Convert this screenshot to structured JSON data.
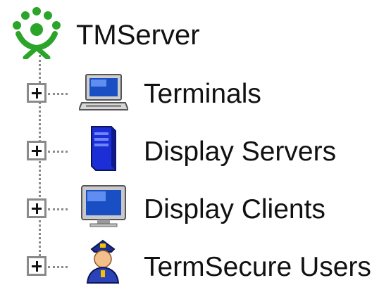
{
  "tree": {
    "root": {
      "label": "TMServer",
      "icon": "tmserver-people-icon"
    },
    "children": [
      {
        "label": "Terminals",
        "icon": "laptop-icon",
        "expander": "+"
      },
      {
        "label": "Display Servers",
        "icon": "server-tower-icon",
        "expander": "+"
      },
      {
        "label": "Display Clients",
        "icon": "monitor-icon",
        "expander": "+"
      },
      {
        "label": "TermSecure Users",
        "icon": "security-officer-icon",
        "expander": "+"
      }
    ]
  },
  "colors": {
    "root_icon": "#2aa52a",
    "connector": "#8a8a8a",
    "server_blue": "#1c2fd6",
    "screen_blue": "#1a4fc4"
  }
}
